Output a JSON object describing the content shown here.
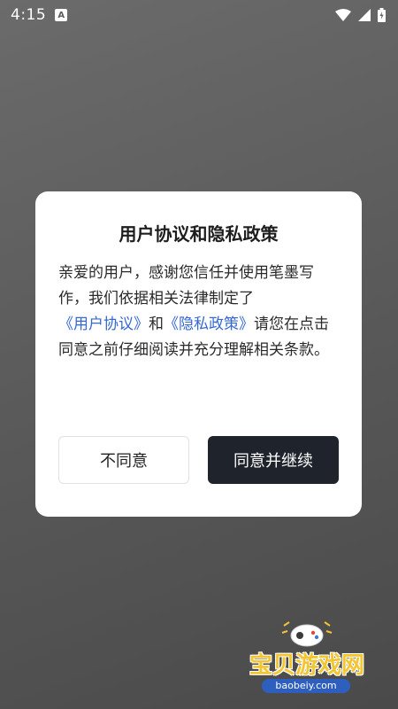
{
  "status_bar": {
    "time": "4:15",
    "notification_icon": "a-icon",
    "icons": [
      "wifi-icon",
      "signal-icon",
      "battery-icon"
    ]
  },
  "dialog": {
    "title": "用户协议和隐私政策",
    "body_part1": "亲爱的用户，感谢您信任并使用笔墨写作，我们依据相关法律制定了",
    "link_user_agreement": "《用户协议》",
    "body_and": "和",
    "link_privacy_policy": "《隐私政策》",
    "body_part2": "请您在点击同意之前仔细阅读并充分理解相关条款。",
    "disagree_label": "不同意",
    "agree_label": "同意并继续"
  },
  "watermark": {
    "brand": "宝贝游戏网",
    "domain": "baobeiy.com"
  },
  "colors": {
    "backdrop": "#5a5a5a",
    "dialog_bg": "#ffffff",
    "link": "#3568d4",
    "agree_button": "#1f232b",
    "watermark_text": "#f3c530"
  }
}
